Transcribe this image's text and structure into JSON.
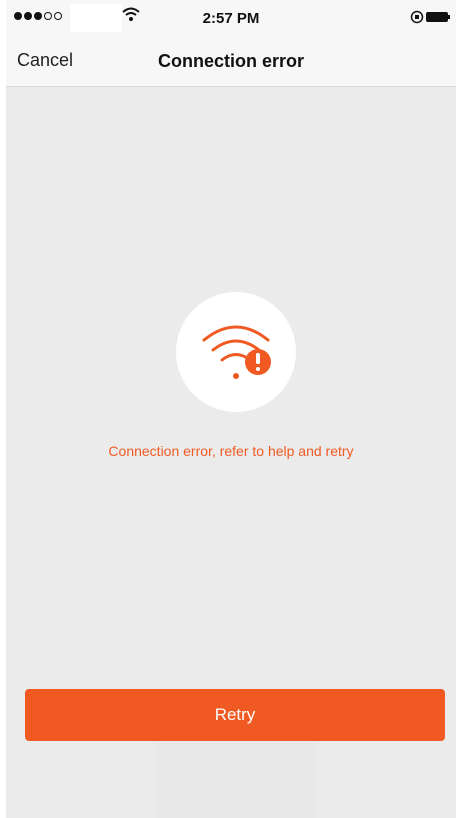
{
  "status_bar": {
    "time": "2:57 PM",
    "signal_dots_filled": 3,
    "signal_dots_total": 5,
    "icons": [
      "wifi-icon",
      "rotation-lock-icon",
      "battery-icon"
    ]
  },
  "nav": {
    "cancel_label": "Cancel",
    "title": "Connection error"
  },
  "main": {
    "icon": "wifi-error-icon",
    "message": "Connection error, refer to help and retry"
  },
  "retry": {
    "label": "Retry"
  },
  "colors": {
    "accent": "#f05a22",
    "background": "#ebebeb",
    "bar": "#f7f7f7"
  }
}
